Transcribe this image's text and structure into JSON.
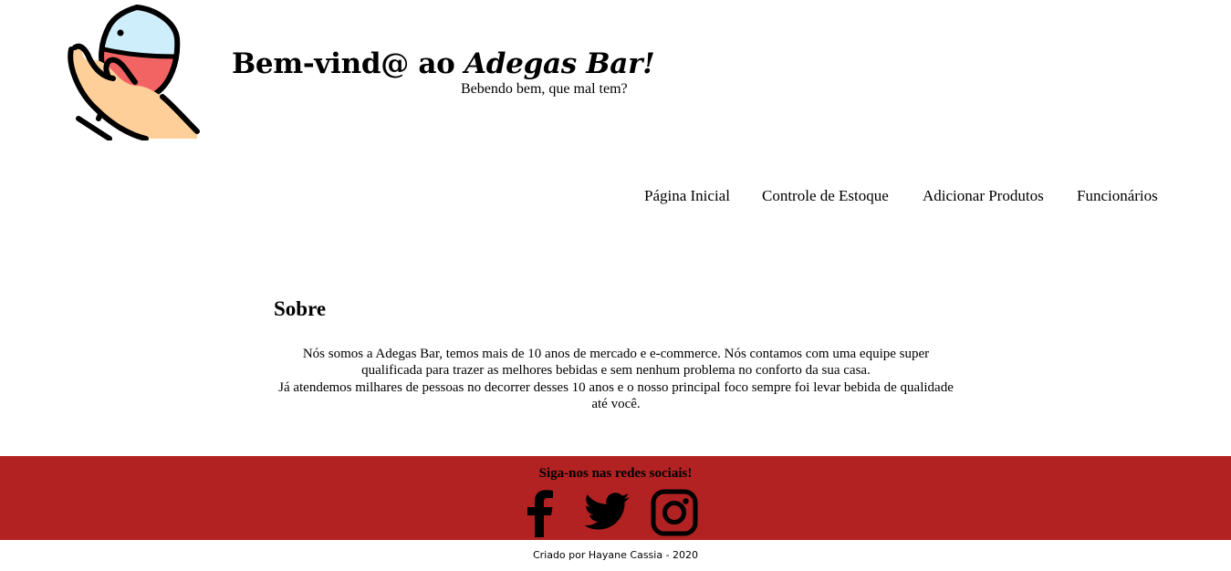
{
  "header": {
    "title_prefix": "Bem-vind@ ao ",
    "title_brand": "Adegas Bar!",
    "tagline": "Bebendo bem, que mal tem?",
    "logo_icon": "wine-glass-in-hand-icon"
  },
  "nav": {
    "items": [
      {
        "label": "Página Inicial"
      },
      {
        "label": "Controle de Estoque"
      },
      {
        "label": "Adicionar Produtos"
      },
      {
        "label": "Funcionários"
      }
    ]
  },
  "about": {
    "title": "Sobre",
    "paragraph_1": "Nós somos a Adegas Bar, temos mais de 10 anos de mercado e e-commerce. Nós contamos com uma equipe super qualificada para trazer as melhores bebidas e sem nenhum problema no conforto da sua casa.",
    "paragraph_2": "Já atendemos milhares de pessoas no decorrer desses 10 anos e o nosso principal foco sempre foi levar bebida de qualidade até você."
  },
  "footer": {
    "heading": "Siga-nos nas redes sociais!",
    "social": [
      "facebook-icon",
      "twitter-icon",
      "instagram-icon"
    ],
    "credits": "Criado por Hayane Cassia - 2020",
    "band_color": "#b22222"
  },
  "colors": {
    "wine": "#f26464",
    "glass": "#cfeefb",
    "skin": "#ffcf99",
    "outline": "#000000"
  }
}
